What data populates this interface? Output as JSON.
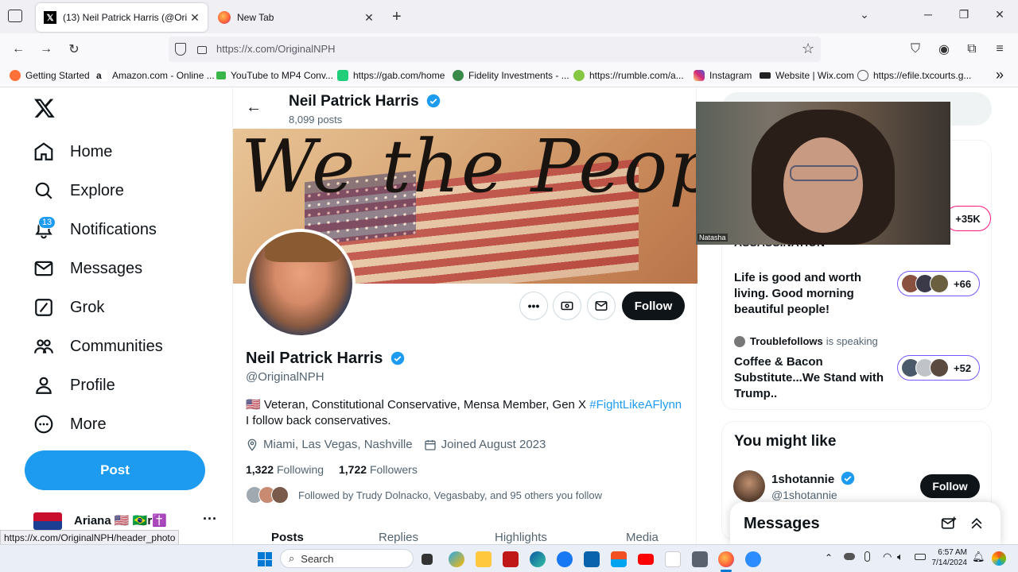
{
  "browser": {
    "tabs": [
      {
        "title": "(13) Neil Patrick Harris (@OriginalNPH)",
        "active": true
      },
      {
        "title": "New Tab",
        "active": false
      }
    ],
    "url": "https://x.com/OriginalNPH",
    "bookmarks": [
      "Getting Started",
      "Amazon.com - Online ...",
      "YouTube to MP4 Conv...",
      "https://gab.com/home",
      "Fidelity Investments - ...",
      "https://rumble.com/a...",
      "Instagram",
      "Website | Wix.com",
      "https://efile.txcourts.g..."
    ],
    "status_url": "https://x.com/OriginalNPH/header_photo"
  },
  "sidebar": {
    "items": [
      {
        "label": "Home",
        "icon": "home-icon"
      },
      {
        "label": "Explore",
        "icon": "search-icon"
      },
      {
        "label": "Notifications",
        "icon": "bell-icon",
        "badge": "13"
      },
      {
        "label": "Messages",
        "icon": "envelope-icon"
      },
      {
        "label": "Grok",
        "icon": "grok-icon"
      },
      {
        "label": "Communities",
        "icon": "people-icon"
      },
      {
        "label": "Profile",
        "icon": "person-icon"
      },
      {
        "label": "More",
        "icon": "more-circle-icon"
      }
    ],
    "post_label": "Post",
    "account_name": "Ariana 🇺🇸 🇧🇷r✝️"
  },
  "profile": {
    "header_name": "Neil Patrick Harris",
    "post_count": "8,099 posts",
    "banner_text": "We the People",
    "name": "Neil Patrick Harris",
    "handle": "@OriginalNPH",
    "bio_line1": "🇺🇸 Veteran, Constitutional Conservative, Mensa Member, Gen X",
    "bio_hashtag": "#FightLikeAFlynn",
    "bio_line2": "I follow back conservatives.",
    "location": "Miami, Las Vegas, Nashville",
    "joined": "Joined August 2023",
    "following_count": "1,322",
    "following_label": "Following",
    "followers_count": "1,722",
    "followers_label": "Followers",
    "followed_by": "Followed by Trudy Dolnacko, Vegasbaby, and 95 others you follow",
    "follow_label": "Follow",
    "tabs": [
      "Posts",
      "Replies",
      "Highlights",
      "Media"
    ]
  },
  "right": {
    "space1_heading": "ASSASSINATION",
    "space1_count": "+35K",
    "space2_title": "Life is good and worth living. Good morning beautiful people!",
    "space2_count": "+66",
    "space3_host": "Troublefollows",
    "space3_status": "is speaking",
    "space3_title": "Coffee & Bacon Substitute...We Stand with Trump..",
    "space3_count": "+52",
    "might_like_title": "You might like",
    "suggest_name": "1shotannie",
    "suggest_handle": "@1shotannie",
    "suggest_follow": "Follow",
    "messages_title": "Messages",
    "video_label": "Natasha"
  },
  "taskbar": {
    "search": "Search",
    "time": "6:57 AM",
    "date": "7/14/2024"
  },
  "colors": {
    "x_blue": "#1d9bf0",
    "spaces_purple": "#7856ff",
    "banner_parchment": "#d9a878"
  }
}
